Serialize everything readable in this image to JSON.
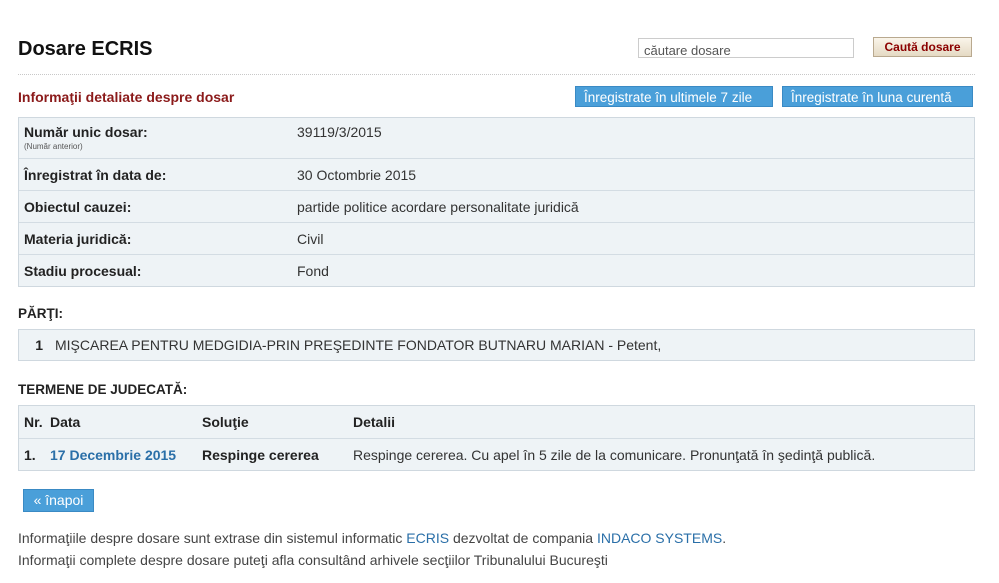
{
  "header": {
    "title": "Dosare ECRIS",
    "search_value": "căutare dosare",
    "search_button": "Caută dosare"
  },
  "details": {
    "subtitle": "Informaţii detaliate despre dosar",
    "btn_last7": "Înregistrate în ultimele 7 zile",
    "btn_month": "Înregistrate în luna curentă",
    "rows": [
      {
        "label": "Număr unic dosar:",
        "sublabel": "(Număr anterior)",
        "value": "39119/3/2015"
      },
      {
        "label": "Înregistrat în data de:",
        "value": "30 Octombrie 2015"
      },
      {
        "label": "Obiectul cauzei:",
        "value": "partide politice acordare personalitate juridică"
      },
      {
        "label": "Materia juridică:",
        "value": "Civil"
      },
      {
        "label": "Stadiu procesual:",
        "value": "Fond"
      }
    ]
  },
  "parti": {
    "heading": "PĂRŢI:",
    "items": [
      {
        "num": "1",
        "text": "MIŞCAREA PENTRU MEDGIDIA-PRIN PREŞEDINTE FONDATOR BUTNARU MARIAN - Petent,"
      }
    ]
  },
  "termene": {
    "heading": "TERMENE DE JUDECATĂ:",
    "columns": [
      "Nr.",
      "Data",
      "Soluţie",
      "Detalii"
    ],
    "rows": [
      {
        "nr": "1.",
        "data": "17 Decembrie 2015",
        "solutie": "Respinge cererea",
        "detalii": "Respinge cererea. Cu apel în 5 zile de la comunicare. Pronunţată în şedinţă publică."
      }
    ]
  },
  "back_label": "« înapoi",
  "footer": {
    "line1_a": "Informaţiile despre dosare sunt extrase din sistemul informatic ",
    "line1_link1": "ECRIS",
    "line1_b": " dezvoltat de compania ",
    "line1_link2": "INDACO SYSTEMS",
    "line1_c": ".",
    "line2": "Informaţii complete despre dosare puteţi afla consultând arhivele secţiilor Tribunalului Bucureşti"
  },
  "colors": {
    "accent_blue": "#4a9fd9",
    "title_red": "#8b1a1a",
    "link_blue": "#2a6fa8"
  }
}
